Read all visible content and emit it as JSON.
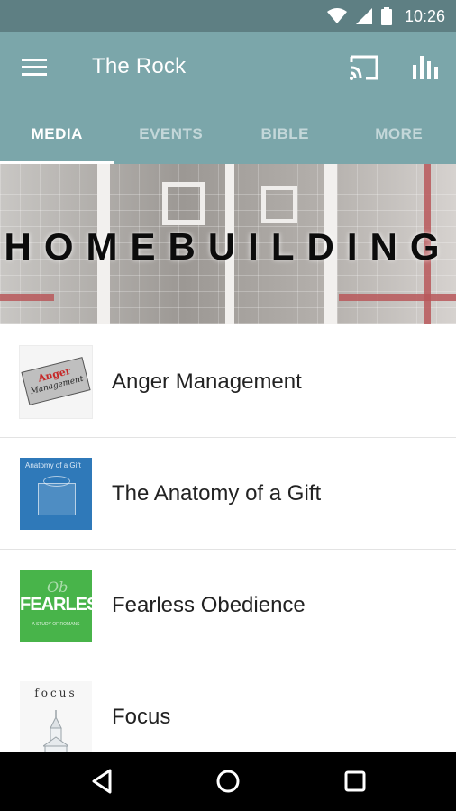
{
  "status_bar": {
    "time": "10:26",
    "icons": [
      "wifi-icon",
      "cell-signal-icon",
      "battery-icon"
    ]
  },
  "app_bar": {
    "title": "The Rock",
    "actions": [
      "menu-icon",
      "cast-icon",
      "stats-icon"
    ]
  },
  "tabs": [
    {
      "label": "MEDIA",
      "active": true
    },
    {
      "label": "EVENTS",
      "active": false
    },
    {
      "label": "BIBLE",
      "active": false
    },
    {
      "label": "MORE",
      "active": false
    }
  ],
  "banner": {
    "title": "HOMEBUILDING"
  },
  "media_list": [
    {
      "label": "Anger Management",
      "thumb": {
        "line1": "Anger",
        "line2": "Management"
      }
    },
    {
      "label": "The Anatomy of a Gift",
      "thumb": {
        "text": "Anatomy of a Gift"
      }
    },
    {
      "label": "Fearless Obedience",
      "thumb": {
        "word": "FEARLESS",
        "script": "Ob",
        "sub": "A STUDY OF ROMANS"
      }
    },
    {
      "label": "Focus",
      "thumb": {
        "word": "focus"
      }
    }
  ],
  "nav_bar": [
    "back-icon",
    "home-icon",
    "recents-icon"
  ],
  "colors": {
    "status_bar": "#5e7f83",
    "app_bar": "#7ba6aa",
    "nav_bar": "#000000",
    "fearless_green": "#48b44a",
    "anatomy_blue": "#2f79b9"
  }
}
